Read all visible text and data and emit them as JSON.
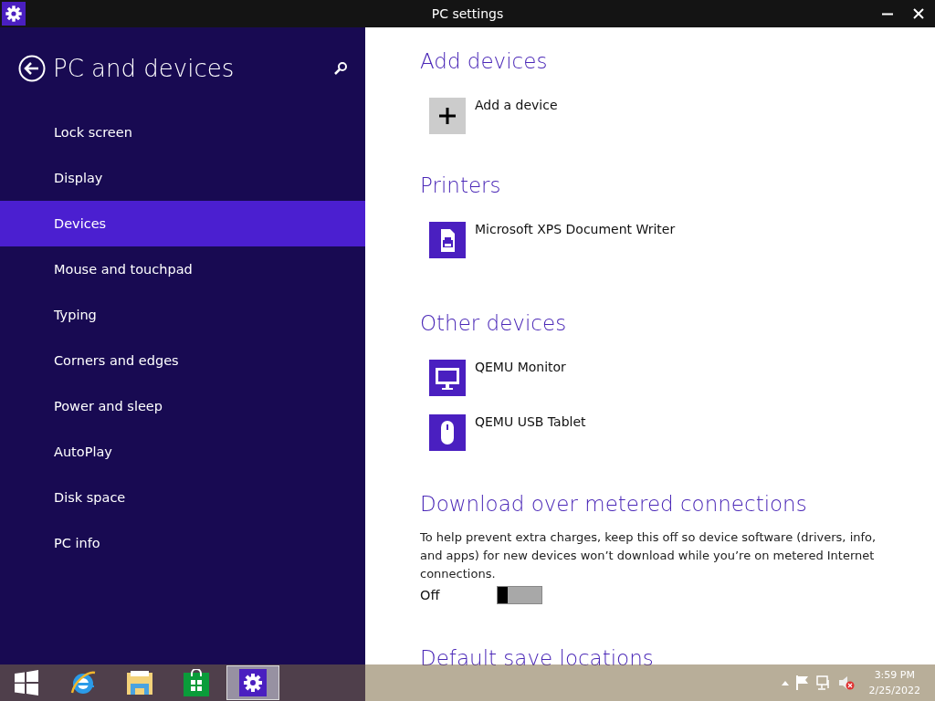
{
  "window": {
    "title": "PC settings"
  },
  "sidebar": {
    "title": "PC and devices",
    "items": [
      {
        "label": "Lock screen",
        "selected": false
      },
      {
        "label": "Display",
        "selected": false
      },
      {
        "label": "Devices",
        "selected": true
      },
      {
        "label": "Mouse and touchpad",
        "selected": false
      },
      {
        "label": "Typing",
        "selected": false
      },
      {
        "label": "Corners and edges",
        "selected": false
      },
      {
        "label": "Power and sleep",
        "selected": false
      },
      {
        "label": "AutoPlay",
        "selected": false
      },
      {
        "label": "Disk space",
        "selected": false
      },
      {
        "label": "PC info",
        "selected": false
      }
    ]
  },
  "sections": [
    {
      "heading": "Add devices",
      "devices": [
        {
          "kind": "add",
          "name": "Add a device"
        }
      ]
    },
    {
      "heading": "Printers",
      "devices": [
        {
          "kind": "printer",
          "name": "Microsoft XPS Document Writer"
        }
      ]
    },
    {
      "heading": "Other devices",
      "devices": [
        {
          "kind": "monitor",
          "name": "QEMU Monitor"
        },
        {
          "kind": "mouse",
          "name": "QEMU USB Tablet"
        }
      ]
    }
  ],
  "metered": {
    "heading": "Download over metered connections",
    "text": "To help prevent extra charges, keep this off so device software (drivers, info, and apps) for new devices won’t download while you’re on metered Internet connections.",
    "toggle_label": "Off",
    "on": false
  },
  "next_heading": "Default save locations",
  "taskbar": {
    "apps": [
      {
        "kind": "ie",
        "selected": false
      },
      {
        "kind": "explorer",
        "selected": false
      },
      {
        "kind": "store",
        "selected": false
      },
      {
        "kind": "settings",
        "selected": true
      }
    ],
    "time": "3:59 PM",
    "date": "2/25/2022"
  }
}
